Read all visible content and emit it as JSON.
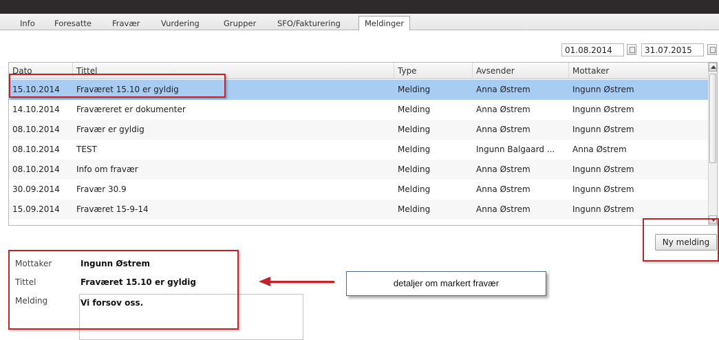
{
  "tabs": [
    {
      "label": "Info",
      "active": false
    },
    {
      "label": "Foresatte",
      "active": false
    },
    {
      "label": "Fravær",
      "active": false
    },
    {
      "label": "Vurdering",
      "active": false
    },
    {
      "label": "Grupper",
      "active": false
    },
    {
      "label": "SFO/Fakturering",
      "active": false
    },
    {
      "label": "Meldinger",
      "active": true
    }
  ],
  "date_range": {
    "from": "01.08.2014",
    "to": "31.07.2015"
  },
  "grid": {
    "columns": [
      "Dato",
      "Tittel",
      "Type",
      "Avsender",
      "Mottaker"
    ],
    "rows": [
      {
        "dato": "15.10.2014",
        "tittel": "Fraværet 15.10 er gyldig",
        "type": "Melding",
        "avsender": "Anna Østrem",
        "mottaker": "Ingunn Østrem",
        "selected": true
      },
      {
        "dato": "14.10.2014",
        "tittel": "Fraværeret er dokumenter",
        "type": "Melding",
        "avsender": "Anna Østrem",
        "mottaker": "Ingunn Østrem",
        "selected": false
      },
      {
        "dato": "08.10.2014",
        "tittel": "Fravær er gyldig",
        "type": "Melding",
        "avsender": "Anna Østrem",
        "mottaker": "Ingunn Østrem",
        "selected": false
      },
      {
        "dato": "08.10.2014",
        "tittel": "TEST",
        "type": "Melding",
        "avsender": "Ingunn Balgaard ...",
        "mottaker": "Anna Østrem",
        "selected": false
      },
      {
        "dato": "08.10.2014",
        "tittel": "Info om fravær",
        "type": "Melding",
        "avsender": "Anna Østrem",
        "mottaker": "Ingunn Østrem",
        "selected": false
      },
      {
        "dato": "30.09.2014",
        "tittel": "Fravær 30.9",
        "type": "Melding",
        "avsender": "Anna Østrem",
        "mottaker": "Ingunn Østrem",
        "selected": false
      },
      {
        "dato": "15.09.2014",
        "tittel": "Fraværet 15-9-14",
        "type": "Melding",
        "avsender": "Anna Østrem",
        "mottaker": "Ingunn Østrem",
        "selected": false
      }
    ]
  },
  "new_message_button": "Ny melding",
  "details": {
    "recipient_label": "Mottaker",
    "recipient_value": "Ingunn Østrem",
    "title_label": "Tittel",
    "title_value": "Fraværet 15.10 er gyldig",
    "message_label": "Melding",
    "message_value": "Vi forsov oss."
  },
  "annotation": {
    "callout_text": "detaljer om markert fravær",
    "highlight_color": "#c0242a"
  },
  "colors": {
    "topbar": "#2e2a2b",
    "selected_row": "#a9cdf2"
  }
}
